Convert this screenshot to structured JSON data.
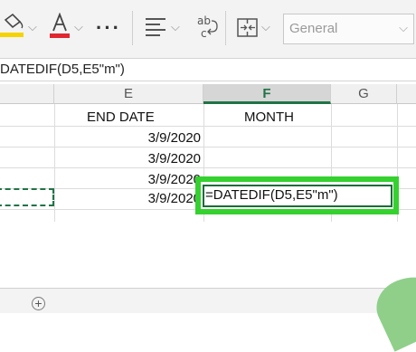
{
  "ribbon": {
    "fill_color": "#f5d300",
    "font_color": "#e0262f",
    "number_format": "General"
  },
  "formula_bar": {
    "text": "DATEDIF(D5,E5\"m\")"
  },
  "columns": [
    "E",
    "F",
    "G"
  ],
  "active_column": "F",
  "headers": {
    "e": "END DATE",
    "f": "MONTH"
  },
  "end_dates": [
    "3/9/2020",
    "3/9/2020",
    "3/9/2020",
    "3/9/2020"
  ],
  "editing_cell": {
    "text": "=DATEDIF(D5,E5\"m\")"
  },
  "colors": {
    "accent": "#217346",
    "highlight": "#35d12f"
  }
}
